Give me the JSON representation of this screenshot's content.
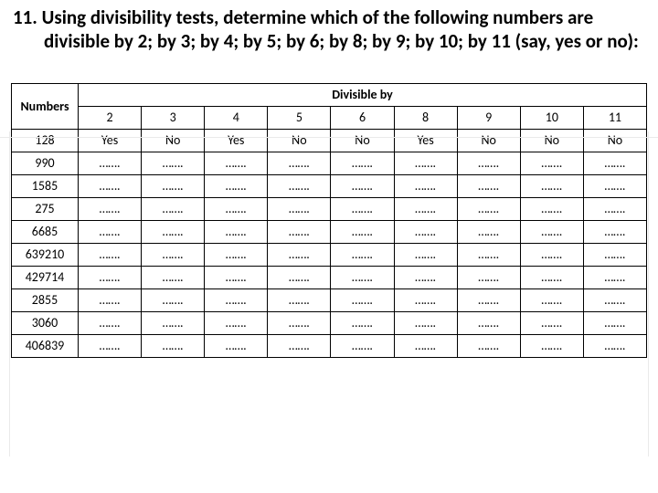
{
  "question": {
    "number": "11.",
    "text": "Using divisibility tests, determine which of the following numbers are divisible by 2; by 3; by 4; by 5; by 6; by 8; by 9; by 10; by 11 (say, yes or no):"
  },
  "table": {
    "header_numbers": "Numbers",
    "header_divisible": "Divisible by",
    "divisors": [
      "2",
      "3",
      "4",
      "5",
      "6",
      "8",
      "9",
      "10",
      "11"
    ],
    "rows": [
      {
        "n": "128",
        "cells": [
          "Yes",
          "No",
          "Yes",
          "No",
          "No",
          "Yes",
          "No",
          "No",
          "No"
        ]
      },
      {
        "n": "990",
        "cells": [
          "…….",
          "…….",
          "…….",
          "…….",
          "…….",
          "…….",
          "…….",
          "…….",
          "……."
        ]
      },
      {
        "n": "1585",
        "cells": [
          "…….",
          "…….",
          "…….",
          "…….",
          "…….",
          "…….",
          "…….",
          "…….",
          "……."
        ]
      },
      {
        "n": "275",
        "cells": [
          "…….",
          "…….",
          "…….",
          "…….",
          "…….",
          "…….",
          "…….",
          "…….",
          "……."
        ]
      },
      {
        "n": "6685",
        "cells": [
          "…….",
          "…….",
          "…….",
          "…….",
          "…….",
          "…….",
          "…….",
          "…….",
          "……."
        ]
      },
      {
        "n": "639210",
        "cells": [
          "…….",
          "…….",
          "…….",
          "…….",
          "…….",
          "…….",
          "…….",
          "…….",
          "……."
        ]
      },
      {
        "n": "429714",
        "cells": [
          "…….",
          "…….",
          "…….",
          "…….",
          "…….",
          "…….",
          "…….",
          "…….",
          "……."
        ]
      },
      {
        "n": "2855",
        "cells": [
          "…….",
          "…….",
          "…….",
          "…….",
          "…….",
          "…….",
          "…….",
          "…….",
          "……."
        ]
      },
      {
        "n": "3060",
        "cells": [
          "…….",
          "…….",
          "…….",
          "…….",
          "…….",
          "…….",
          "…….",
          "…….",
          "……."
        ]
      },
      {
        "n": "406839",
        "cells": [
          "…….",
          "…….",
          "…….",
          "…….",
          "…….",
          "…….",
          "…….",
          "…….",
          "……."
        ]
      }
    ]
  }
}
